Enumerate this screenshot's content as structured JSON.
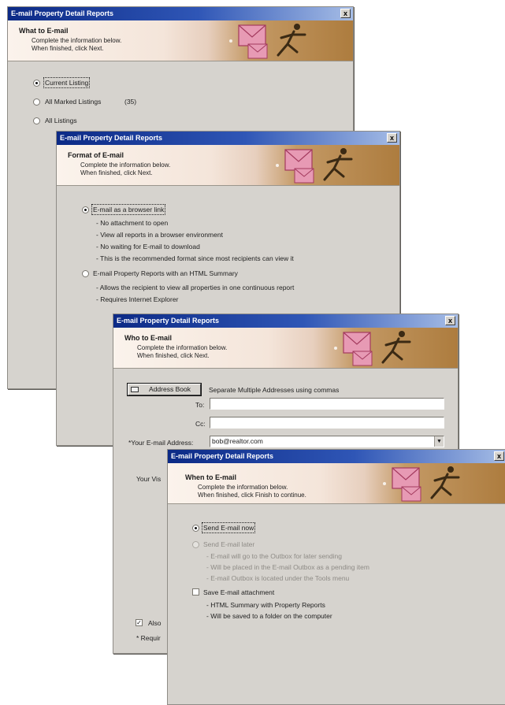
{
  "dialog1": {
    "title": "E-mail Property Detail Reports",
    "close": "x",
    "header_title": "What to E-mail",
    "header_line1": "Complete the information below.",
    "header_line2": "When finished, click Next.",
    "option1": "Current Listing",
    "option2": "All Marked Listings",
    "option2_count": "(35)",
    "option3": "All Listings"
  },
  "dialog2": {
    "title": "E-mail Property Detail Reports",
    "close": "x",
    "header_title": "Format of E-mail",
    "header_line1": "Complete the information below.",
    "header_line2": "When finished, click Next.",
    "option1": "E-mail as a browser link",
    "option1_notes": [
      "- No attachment to open",
      "- View all reports in a browser environment",
      "- No waiting for E-mail to download",
      "- This is the recommended format since most recipients can view it"
    ],
    "option2": "E-mail Property Reports with an HTML Summary",
    "option2_notes": [
      "- Allows the recipient to view all properties in one continuous report",
      "- Requires Internet Explorer"
    ]
  },
  "dialog3": {
    "title": "E-mail Property Detail Reports",
    "close": "x",
    "header_title": "Who to E-mail",
    "header_line1": "Complete the information below.",
    "header_line2": "When finished, click Next.",
    "address_book": "Address Book",
    "separate_hint": "Separate Multiple Addresses using commas",
    "to_label": "To:",
    "cc_label": "Cc:",
    "your_email_label": "*Your E-mail Address:",
    "your_email_value": "bob@realtor.com",
    "your_label_partial": "Your Vis",
    "also_partial": "Also",
    "required_partial": "* Requir"
  },
  "dialog4": {
    "title": "E-mail Property Detail Reports",
    "close": "x",
    "header_title": "When to E-mail",
    "header_line1": "Complete the information below.",
    "header_line2": "When finished, click Finish to continue.",
    "option1": "Send E-mail now",
    "option2": "Send E-mail later",
    "option2_notes": [
      "- E-mail will go to the Outbox for later sending",
      "- Will be placed in the E-mail Outbox as a pending item",
      "- E-mail Outbox is located under the Tools menu"
    ],
    "option3": "Save E-mail attachment",
    "option3_notes": [
      "- HTML Summary with Property Reports",
      "- Will be saved to a folder on the computer"
    ]
  },
  "colors": {
    "dialog_bg": "#d6d3ce",
    "titlebar_start": "#0c2a86",
    "titlebar_end": "#a6bde6",
    "envelope_pink": "#e79ab4",
    "header_brown": "#ad7c3e"
  },
  "icons": [
    "envelope-icon",
    "runner-icon",
    "close-icon",
    "address-book-icon",
    "dropdown-arrow-icon"
  ]
}
